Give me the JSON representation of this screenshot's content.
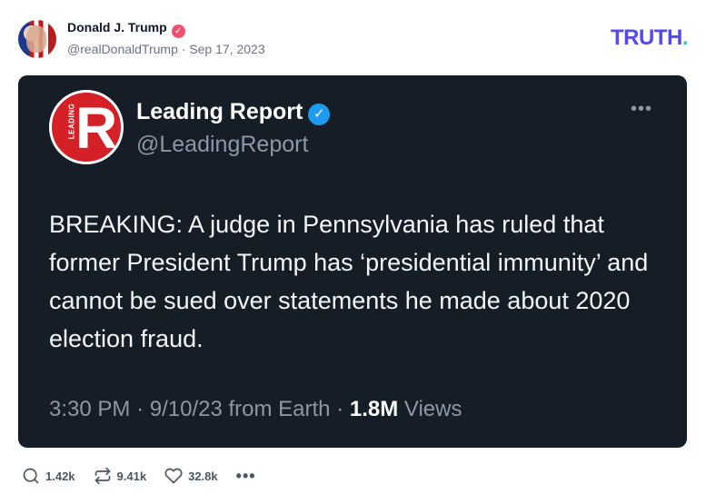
{
  "author": {
    "name": "Donald J. Trump",
    "handle": "@realDonaldTrump",
    "separator": "·",
    "date": "Sep 17, 2023"
  },
  "brand": {
    "logo_text": "TRUTH",
    "logo_dot": ".",
    "logo_color": "#5448ee",
    "dot_color": "#36c6c6"
  },
  "embedded_post": {
    "name": "Leading Report",
    "handle": "@LeadingReport",
    "avatar_letter": "R",
    "avatar_small_text": "LEADING",
    "more_label": "•••",
    "text": "BREAKING: A judge in Pennsylvania has ruled that former President Trump has ‘presidential immunity’ and cannot be sued over statements he made about 2020 election fraud.",
    "time": "3:30 PM",
    "date_source": "9/10/23 from Earth",
    "views_count": "1.8M",
    "views_label": "Views",
    "separator": "·"
  },
  "actions": {
    "replies": "1.42k",
    "retruths": "9.41k",
    "likes": "32.8k",
    "more_label": "•••",
    "icons": [
      "comment-icon",
      "retruth-icon",
      "heart-icon",
      "more-icon"
    ]
  }
}
